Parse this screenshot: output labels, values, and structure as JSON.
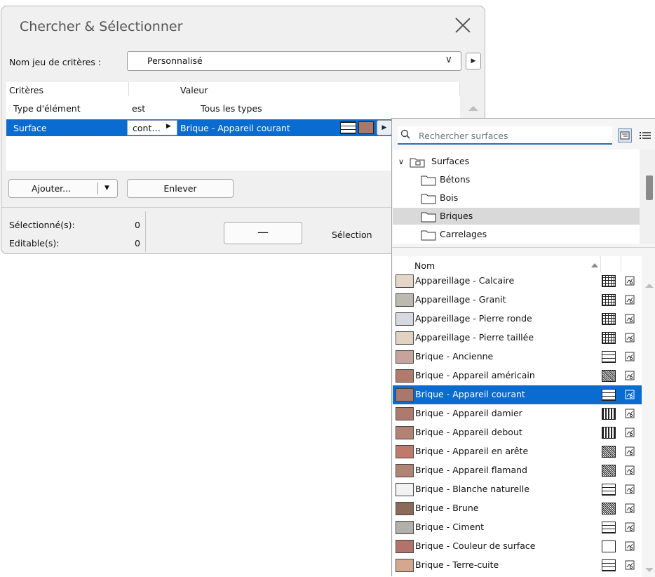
{
  "dialog": {
    "title": "Chercher & Sélectionner",
    "criteria_set": {
      "label": "Nom jeu de critères :",
      "value": "Personnalisé"
    },
    "criteria_table": {
      "headers": [
        "Critères",
        "Valeur"
      ],
      "rows": [
        {
          "criterion": "Type d'élément",
          "operator": "est",
          "value": "Tous les types"
        },
        {
          "criterion": "Surface",
          "operator": "cont…",
          "value": "Brique - Appareil courant",
          "swatch_color": "#a8786a"
        }
      ]
    },
    "buttons": {
      "add": "Ajouter...",
      "remove": "Enlever",
      "selection_dash": "—"
    },
    "stats": {
      "selected_label": "Sélectionné(s):",
      "selected_value": "0",
      "editable_label": "Editable(s):",
      "editable_value": "0"
    },
    "selection_label": "Sélection"
  },
  "popup": {
    "search": {
      "placeholder": "Rechercher surfaces",
      "value": ""
    },
    "tree": {
      "root": "Surfaces",
      "folders": [
        "Bétons",
        "Bois",
        "Briques",
        "Carrelages"
      ],
      "selected": "Briques"
    },
    "list": {
      "header": "Nom",
      "items": [
        {
          "name": "Appareillage - Calcaire",
          "color": "#e6d6c8",
          "pattern": "stone"
        },
        {
          "name": "Appareillage - Granit",
          "color": "#bdb8b0",
          "pattern": "stone"
        },
        {
          "name": "Appareillage - Pierre ronde",
          "color": "#d6dae0",
          "pattern": "stone"
        },
        {
          "name": "Appareillage - Pierre taillée",
          "color": "#e2d2c2",
          "pattern": "stone"
        },
        {
          "name": "Brique - Ancienne",
          "color": "#c4a49c",
          "pattern": "brick"
        },
        {
          "name": "Brique - Appareil américain",
          "color": "#b07b6c",
          "pattern": "dense"
        },
        {
          "name": "Brique - Appareil courant",
          "color": "#a8786a",
          "pattern": "brick",
          "selected": true
        },
        {
          "name": "Brique - Appareil damier",
          "color": "#ad7b6d",
          "pattern": "grid"
        },
        {
          "name": "Brique - Appareil debout",
          "color": "#b28272",
          "pattern": "grid"
        },
        {
          "name": "Brique - Appareil en arête",
          "color": "#c07a6c",
          "pattern": "dense"
        },
        {
          "name": "Brique - Appareil flamand",
          "color": "#b08474",
          "pattern": "dense"
        },
        {
          "name": "Brique - Blanche naturelle",
          "color": "#f2f2f2",
          "pattern": "brick"
        },
        {
          "name": "Brique - Brune",
          "color": "#8c6a5a",
          "pattern": "dense"
        },
        {
          "name": "Brique - Ciment",
          "color": "#b2b0aa",
          "pattern": "brick"
        },
        {
          "name": "Brique - Couleur de surface",
          "color": "#b07468",
          "pattern": "blank"
        },
        {
          "name": "Brique - Terre-cuite",
          "color": "#d4a88e",
          "pattern": "brick"
        }
      ]
    }
  },
  "colors": {
    "accent": "#0a6bd1",
    "dialog_bg": "#f0f0f0"
  }
}
